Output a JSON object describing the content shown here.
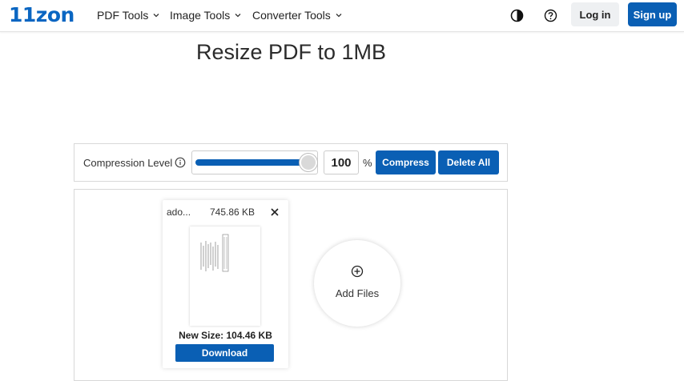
{
  "header": {
    "logo": "11zon",
    "nav": [
      {
        "label": "PDF Tools"
      },
      {
        "label": "Image Tools"
      },
      {
        "label": "Converter Tools"
      }
    ],
    "theme_icon": "contrast-icon",
    "help_icon": "help-icon",
    "login_label": "Log in",
    "signup_label": "Sign up",
    "accent": "#0a5fb4"
  },
  "page": {
    "title": "Resize PDF to 1MB"
  },
  "toolbar": {
    "compression_label": "Compression Level",
    "compression_value": 100,
    "compression_display": "100",
    "percent_sign": "%",
    "compress_label": "Compress",
    "delete_all_label": "Delete All"
  },
  "files": [
    {
      "name": "ado...",
      "size": "745.86 KB",
      "new_size": "New Size: 104.46 KB",
      "download_label": "Download"
    }
  ],
  "add_files": {
    "label": "Add Files"
  }
}
